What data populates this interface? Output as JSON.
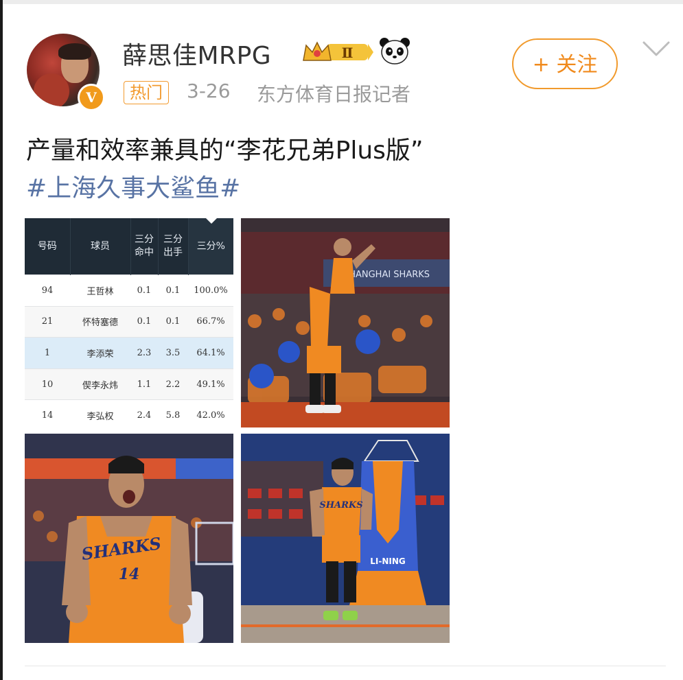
{
  "post": {
    "author": {
      "name": "薛思佳MRPG",
      "verified_badge": "V",
      "level_badge": "Ⅱ"
    },
    "tag": "热门",
    "date": "3-26",
    "source": "东方体育日报记者",
    "follow_label": "+ 关注",
    "text": "产量和效率兼具的“李花兄弟Plus版”",
    "topic": "#上海久事大鲨鱼#"
  },
  "stats_table": {
    "headers": {
      "number": "号码",
      "player": "球员",
      "made_line1": "三分",
      "made_line2": "命中",
      "att_line1": "三分",
      "att_line2": "出手",
      "pct": "三分%"
    },
    "rows": [
      {
        "number": "94",
        "player": "王哲林",
        "made": "0.1",
        "att": "0.1",
        "pct": "100.0%"
      },
      {
        "number": "21",
        "player": "怀特塞德",
        "made": "0.1",
        "att": "0.1",
        "pct": "66.7%"
      },
      {
        "number": "1",
        "player": "李添荣",
        "made": "2.3",
        "att": "3.5",
        "pct": "64.1%"
      },
      {
        "number": "10",
        "player": "偰李永炜",
        "made": "1.1",
        "att": "2.2",
        "pct": "49.1%"
      },
      {
        "number": "14",
        "player": "李弘权",
        "made": "2.4",
        "att": "5.8",
        "pct": "42.0%"
      }
    ]
  },
  "photos": {
    "photo2_banner": "SHANGHAI SHARKS",
    "photo3_jersey_text": "SHARKS",
    "photo3_jersey_number": "14",
    "photo4_jersey_text": "SHARKS",
    "photo4_stanchion_logo": "LI-NING"
  },
  "colors": {
    "accent_orange": "#f19a2c",
    "topic_blue": "#5873a4",
    "muted_gray": "#9a9a9a",
    "table_header": "#1f2b36",
    "row_highlight": "#dcecf8"
  },
  "icons": [
    "crown-level-badge-icon",
    "panda-icon",
    "chevron-down-icon",
    "verified-v-icon"
  ]
}
